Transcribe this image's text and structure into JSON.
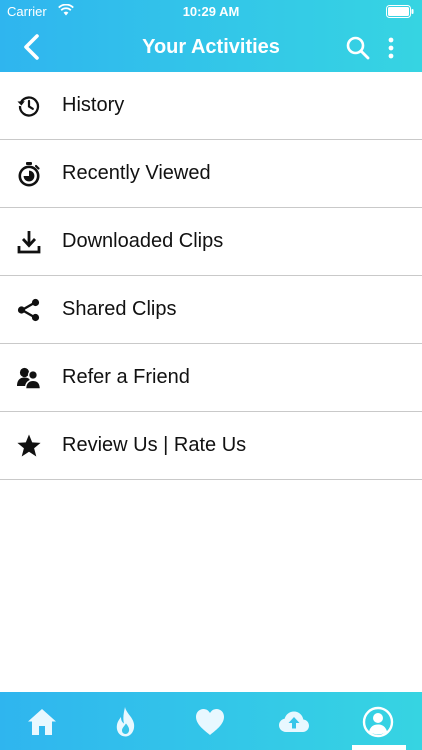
{
  "status_bar": {
    "carrier": "Carrier",
    "time": "10:29 AM"
  },
  "header": {
    "title": "Your Activities"
  },
  "menu": {
    "items": [
      {
        "label": "History",
        "icon": "history-icon"
      },
      {
        "label": "Recently Viewed",
        "icon": "stopwatch-icon"
      },
      {
        "label": "Downloaded Clips",
        "icon": "download-icon"
      },
      {
        "label": "Shared Clips",
        "icon": "share-icon"
      },
      {
        "label": "Refer a Friend",
        "icon": "people-icon"
      },
      {
        "label": "Review Us | Rate Us",
        "icon": "star-icon"
      }
    ]
  },
  "tabbar": {
    "tabs": [
      {
        "icon": "home-icon",
        "selected": false
      },
      {
        "icon": "flame-icon",
        "selected": false
      },
      {
        "icon": "heart-icon",
        "selected": false
      },
      {
        "icon": "cloud-upload-icon",
        "selected": false
      },
      {
        "icon": "profile-icon",
        "selected": true
      }
    ]
  },
  "colors": {
    "header_gradient_start": "#2fb5ef",
    "header_gradient_end": "#36d4e2",
    "divider": "#c9c9c9",
    "text": "#111111",
    "tab_icon": "#e8f8ff"
  }
}
